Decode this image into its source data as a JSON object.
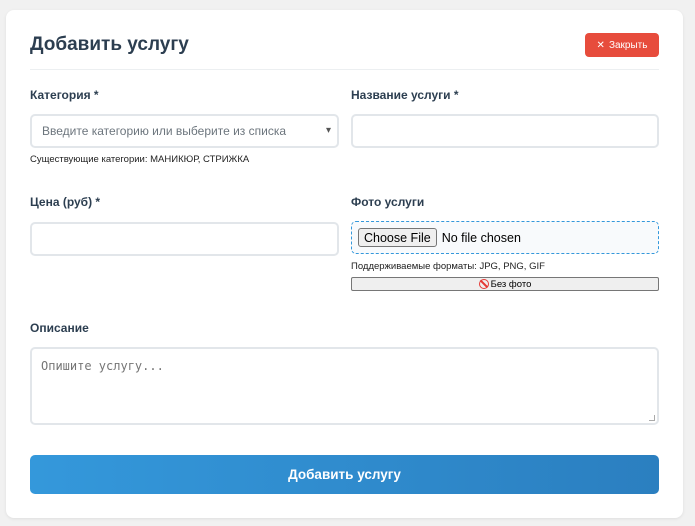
{
  "header": {
    "title": "Добавить услугу",
    "close_label": "Закрыть",
    "close_icon": "✕"
  },
  "form": {
    "category": {
      "label": "Категория *",
      "placeholder": "Введите категорию или выберите из списка",
      "chevron": "▾",
      "hint": "Существующие категории: МАНИКЮР, СТРИЖКА"
    },
    "name": {
      "label": "Название услуги *",
      "value": ""
    },
    "price": {
      "label": "Цена (руб) *",
      "value": ""
    },
    "photo": {
      "label": "Фото услуги",
      "choose_label": "Choose File",
      "status": "No file chosen",
      "hint": "Поддерживаемые форматы: JPG, PNG, GIF",
      "no_photo_label": "Без фото",
      "no_photo_icon": "no-entry-icon"
    },
    "description": {
      "label": "Описание",
      "placeholder": "Опишите услугу..."
    },
    "submit_label": "Добавить услугу"
  },
  "colors": {
    "close_button": "#e74c3c",
    "submit_start": "#3498db",
    "submit_end": "#2b7fc0",
    "title": "#2c3e50"
  }
}
